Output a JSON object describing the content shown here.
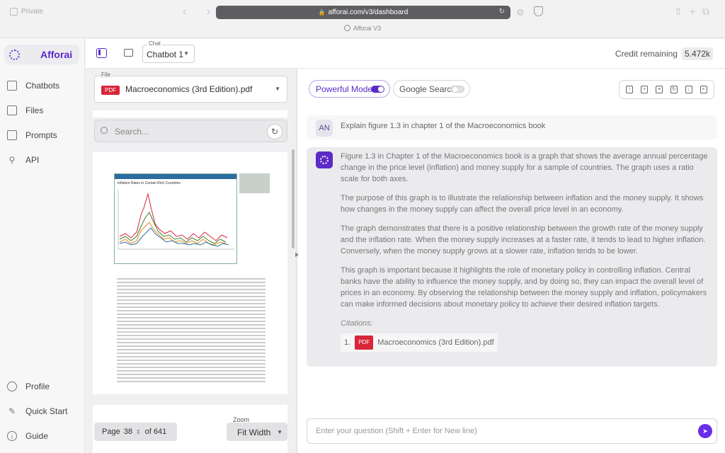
{
  "browser": {
    "private_label": "Private",
    "url": "afforai.com/v3/dashboard",
    "tab_title": "Afforai V3"
  },
  "brand": {
    "name": "Afforai",
    "accent": "#5b2bc7"
  },
  "sidebar": {
    "items": [
      {
        "label": "Chatbots",
        "icon": "chat-bubbles-icon"
      },
      {
        "label": "Files",
        "icon": "file-icon"
      },
      {
        "label": "Prompts",
        "icon": "prompt-icon"
      },
      {
        "label": "API",
        "icon": "plug-icon"
      }
    ],
    "bottom_items": [
      {
        "label": "Profile",
        "icon": "user-icon"
      },
      {
        "label": "Quick Start",
        "icon": "magic-wand-icon"
      },
      {
        "label": "Guide",
        "icon": "info-icon"
      }
    ]
  },
  "toolbar": {
    "chat_legend": "Chat",
    "chat_value": "Chatbot 1",
    "credit_label": "Credit remaining",
    "credit_value": "5.472k"
  },
  "file_pane": {
    "file_legend": "File",
    "pdf_badge": "PDF",
    "file_name": "Macroeconomics (3rd Edition).pdf",
    "search_placeholder": "Search...",
    "figure_title": "Inflation Rates in Certain Rich Countries",
    "page_label": "Page",
    "page_number": "38",
    "page_of": "of 641",
    "zoom_legend": "Zoom",
    "zoom_value": "Fit Width"
  },
  "chat": {
    "powerful_mode": "Powerful Mode",
    "powerful_mode_on": true,
    "google_search": "Google Search",
    "google_search_on": false,
    "user_initials": "AN",
    "user_message": "Explain figure 1.3 in chapter 1 of the Macroeconomics book",
    "bot_paragraphs": [
      "Figure 1.3 in Chapter 1 of the Macroeconomics book is a graph that shows the average annual percentage change in the price level (inflation) and money supply for a sample of countries. The graph uses a ratio scale for both axes.",
      "The purpose of this graph is to illustrate the relationship between inflation and the money supply. It shows how changes in the money supply can affect the overall price level in an economy.",
      "The graph demonstrates that there is a positive relationship between the growth rate of the money supply and the inflation rate. When the money supply increases at a faster rate, it tends to lead to higher inflation. Conversely, when the money supply grows at a slower rate, inflation tends to be lower.",
      "This graph is important because it highlights the role of monetary policy in controlling inflation. Central banks have the ability to influence the money supply, and by doing so, they can impact the overall level of prices in an economy. By observing the relationship between the money supply and inflation, policymakers can make informed decisions about monetary policy to achieve their desired inflation targets."
    ],
    "citations_label": "Citations:",
    "citation_index": "1.",
    "citation_badge": "PDF",
    "citation_file": "Macroeconomics (3rd Edition).pdf",
    "composer_placeholder": "Enter your question (Shift + Enter for New line)"
  }
}
